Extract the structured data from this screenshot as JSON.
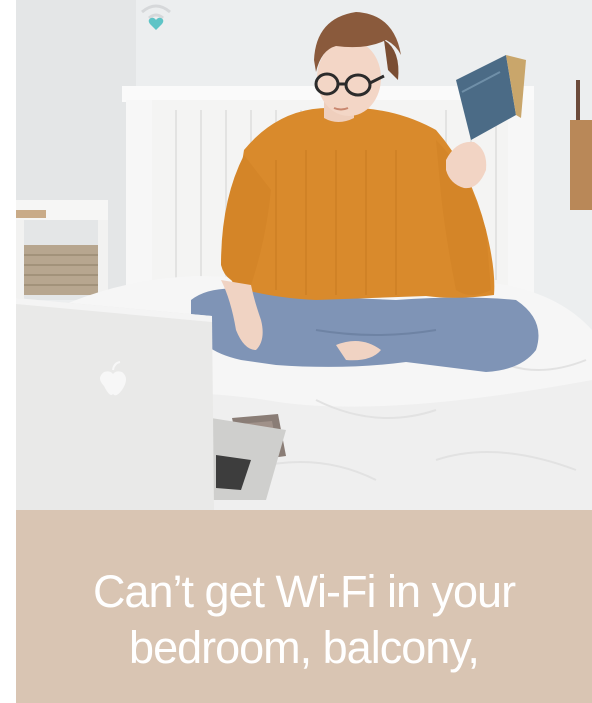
{
  "hero": {
    "icon": "wifi-heart-icon",
    "laptop_logo": "apple-logo-icon"
  },
  "caption": {
    "line1": "Can’t get Wi-Fi in your",
    "line2": "bedroom, balcony,"
  },
  "colors": {
    "caption_bg": "#d9c5b3",
    "caption_text": "#ffffff",
    "sweater": "#d98a2c",
    "jeans": "#7e93b5",
    "heart_accent": "#5ec4c6"
  }
}
